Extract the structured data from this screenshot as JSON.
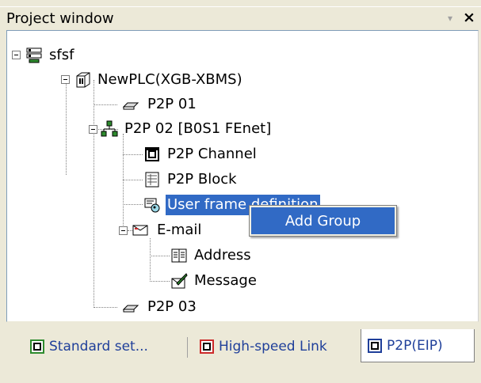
{
  "window": {
    "title": "Project window",
    "pin_glyph": "▾",
    "close_glyph": "×"
  },
  "tree": {
    "nodes": [
      {
        "label": "sfsf",
        "icon": "project-icon"
      },
      {
        "label": "NewPLC(XGB-XBMS)",
        "icon": "plc-icon"
      },
      {
        "label": "P2P 01",
        "icon": "p2p-module-icon"
      },
      {
        "label": "P2P 02 [B0S1 FEnet]",
        "icon": "network-icon"
      },
      {
        "label": "P2P Channel",
        "icon": "p2p-channel-icon"
      },
      {
        "label": "P2P Block",
        "icon": "p2p-block-icon"
      },
      {
        "label": "User frame definition",
        "icon": "user-frame-icon",
        "selected": true
      },
      {
        "label": "E-mail",
        "icon": "email-icon"
      },
      {
        "label": "Address",
        "icon": "address-book-icon"
      },
      {
        "label": "Message",
        "icon": "message-icon"
      },
      {
        "label": "P2P 03",
        "icon": "p2p-module-icon"
      }
    ]
  },
  "context_menu": {
    "items": [
      {
        "label": "Add Group"
      }
    ]
  },
  "tabs": [
    {
      "label": "Standard set...",
      "icon": "standard-settings-icon",
      "icon_color": "#2e8b2e"
    },
    {
      "label": "High-speed Link",
      "icon": "high-speed-link-icon",
      "icon_color": "#cc2a2a"
    },
    {
      "label": "P2P(EIP)",
      "icon": "p2p-eip-icon",
      "icon_color": "#1f3f9a",
      "active": true
    }
  ],
  "colors": {
    "selection": "#316ac5",
    "background": "#ece9d8",
    "tab_text": "#1f3f9a"
  }
}
